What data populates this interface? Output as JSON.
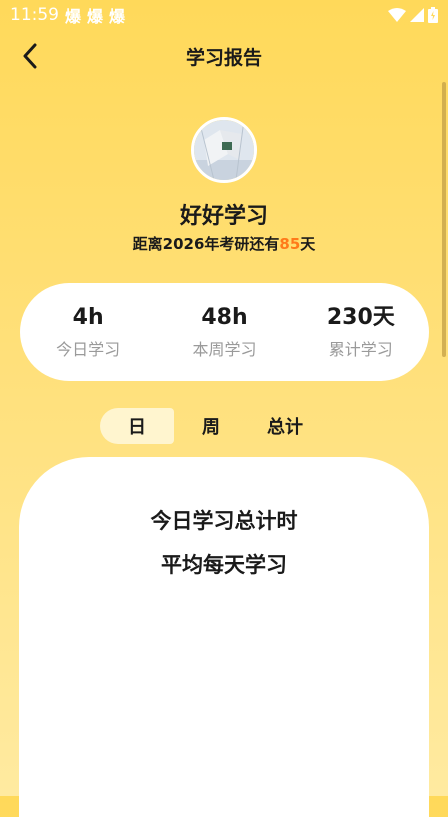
{
  "status_bar": {
    "time": "11:59",
    "notification_glyph": "爆"
  },
  "header": {
    "title": "学习报告"
  },
  "profile": {
    "username": "好好学习",
    "countdown_prefix": "距离2026年考研还有",
    "countdown_days": "85",
    "countdown_suffix": "天"
  },
  "stats": [
    {
      "value": "4h",
      "label": "今日学习"
    },
    {
      "value": "48h",
      "label": "本周学习"
    },
    {
      "value": "230天",
      "label": "累计学习"
    }
  ],
  "tabs": [
    {
      "label": "日",
      "active": true
    },
    {
      "label": "周",
      "active": false
    },
    {
      "label": "总计",
      "active": false
    }
  ],
  "content": {
    "line1": "今日学习总计时",
    "line2": "平均每天学习"
  },
  "colors": {
    "accent": "#FFD95A",
    "highlight": "#FF7A1A",
    "card": "#ffffff"
  }
}
